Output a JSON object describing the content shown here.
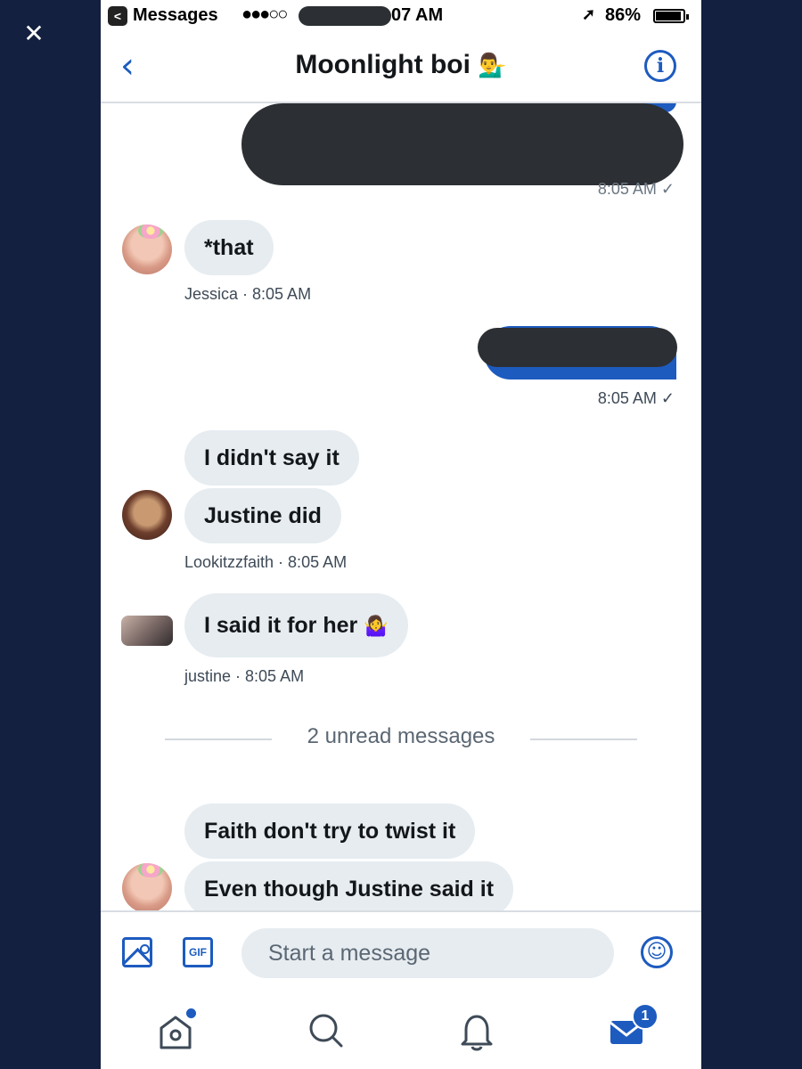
{
  "viewer": {
    "close_glyph": "✕"
  },
  "status_bar": {
    "back_app_glyph": "<",
    "app_name": "Messages",
    "signal": "●●●○○",
    "time_visible": "07 AM",
    "location_glyph": "➚",
    "battery": "86%"
  },
  "header": {
    "back_glyph": "‹",
    "title": "Moonlight boi",
    "title_emoji": "💁‍♂️",
    "info_glyph": "i"
  },
  "chat": {
    "sent_1": {
      "meta": "8:05 AM ✓"
    },
    "jessica_1": {
      "text": "*that",
      "meta": "Jessica · 8:05 AM"
    },
    "sent_2": {
      "meta": "8:05 AM ✓"
    },
    "faith": {
      "messages": [
        "I didn't say it",
        "Justine did"
      ],
      "meta": "Lookitzzfaith · 8:05 AM"
    },
    "justine": {
      "text": "I said it for her",
      "emoji": "🤷‍♀️",
      "meta": "justine · 8:05 AM"
    },
    "unread_divider": "2 unread messages",
    "jessica_2": {
      "messages": [
        "Faith don't try to twist it",
        "Even though Justine said it"
      ]
    }
  },
  "composer": {
    "gif_label": "GIF",
    "placeholder": "Start a message",
    "emoji_glyph": "☺"
  },
  "tab_bar": {
    "mail_badge": "1",
    "icons": [
      "home-icon",
      "search-icon",
      "bell-icon",
      "mail-icon"
    ]
  },
  "colors": {
    "accent": "#1d5bbf",
    "bubble_received": "#e6ecf0",
    "outer_bg": "#13203f"
  }
}
